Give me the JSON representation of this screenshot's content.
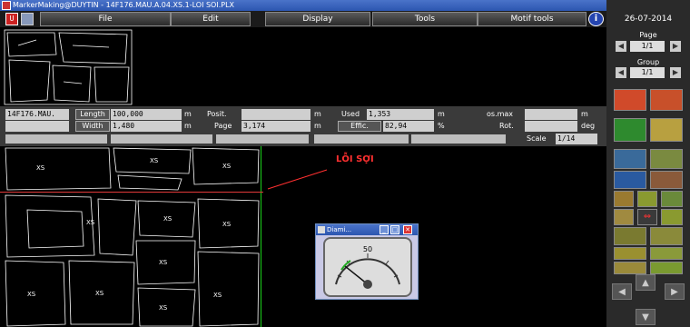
{
  "window": {
    "title": "MarkerMaking@DUYTIN - 14F176.MAU.A.04.XS.1-LOI SOI.PLX"
  },
  "toolbar": {
    "red_button_label": "U"
  },
  "menu": {
    "items": [
      {
        "label": "File"
      },
      {
        "label": "Edit"
      },
      {
        "label": "Display"
      },
      {
        "label": "Tools"
      },
      {
        "label": "Motif tools"
      }
    ],
    "info_label": "i"
  },
  "sidebar": {
    "date": "26-07-2014",
    "page_label": "Page",
    "page_value": "1/1",
    "group_label": "Group",
    "group_value": "1/1",
    "left_arrow": "◀",
    "right_arrow": "▶",
    "up_arrow": "▲",
    "down_arrow": "▼"
  },
  "info": {
    "marker_name": "14F176.MAU.",
    "length_label": "Length",
    "length_value": "100,000",
    "length_unit": "m",
    "width_label": "Width",
    "width_value": "1,480",
    "width_unit": "m",
    "posit_label": "Posit.",
    "posit_unit": "m",
    "page_label": "Page",
    "page_value": "3,174",
    "page_unit": "m",
    "used_label": "Used",
    "used_value": "1,353",
    "used_unit": "m",
    "effic_label": "Effic.",
    "effic_value": "82,94",
    "effic_unit": "%",
    "pos_max_label": "os.max",
    "pos_max_unit": "m",
    "rot_label": "Rot.",
    "rot_unit": "deg",
    "scale_label": "Scale",
    "scale_value": "1/14"
  },
  "annotation": {
    "text": "LỖI SỢI"
  },
  "dial_window": {
    "title": "Diami...",
    "gauge_value": "50",
    "minimize": "_",
    "maximize": "□",
    "close": "✕"
  }
}
